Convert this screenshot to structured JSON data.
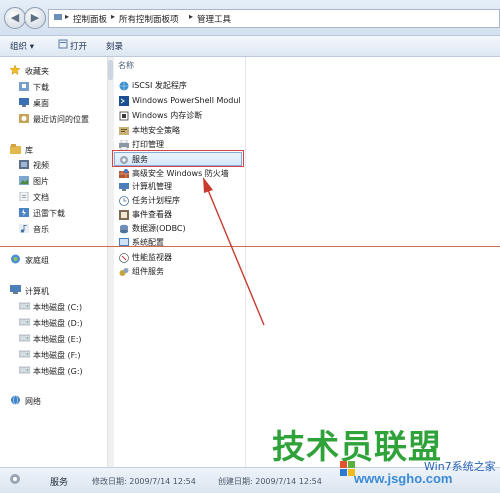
{
  "address_bar": {
    "crumbs": [
      "控制面板",
      "所有控制面板项",
      "管理工具"
    ]
  },
  "toolbar": {
    "organize_label": "组织 ▾",
    "open_label": "打开",
    "burn_label": "刻录"
  },
  "nav": {
    "favorites": {
      "label": "收藏夹",
      "items": [
        "下载",
        "桌面",
        "最近访问的位置"
      ]
    },
    "libraries": {
      "label": "库",
      "items": [
        "视频",
        "图片",
        "文档",
        "迅雷下载",
        "音乐"
      ]
    },
    "homegroup": {
      "label": "家庭组"
    },
    "computer": {
      "label": "计算机",
      "items": [
        "本地磁盘 (C:)",
        "本地磁盘 (D:)",
        "本地磁盘 (E:)",
        "本地磁盘 (F:)",
        "本地磁盘 (G:)"
      ]
    },
    "network": {
      "label": "网络"
    }
  },
  "content": {
    "column_header": "名称",
    "files": [
      "iSCSI 发起程序",
      "Windows PowerShell Modul",
      "Windows 内存诊断",
      "本地安全策略",
      "打印管理",
      "服务",
      "高级安全 Windows 防火墙",
      "计算机管理",
      "任务计划程序",
      "事件查看器",
      "数据源(ODBC)",
      "系统配置",
      "性能监视器",
      "组件服务"
    ],
    "selected": "服务"
  },
  "status": {
    "name": "服务",
    "modified": "修改日期: 2009/7/14 12:54",
    "created": "创建日期: 2009/7/14 12:54"
  },
  "watermark": {
    "brand": "技术员联盟",
    "small": "Win7系统之家",
    "site": "www.jsgho.com"
  },
  "colors": {
    "accent": "#3a7bd5",
    "highlight_box": "#d64545",
    "watermark_green": "#2fa23a"
  }
}
